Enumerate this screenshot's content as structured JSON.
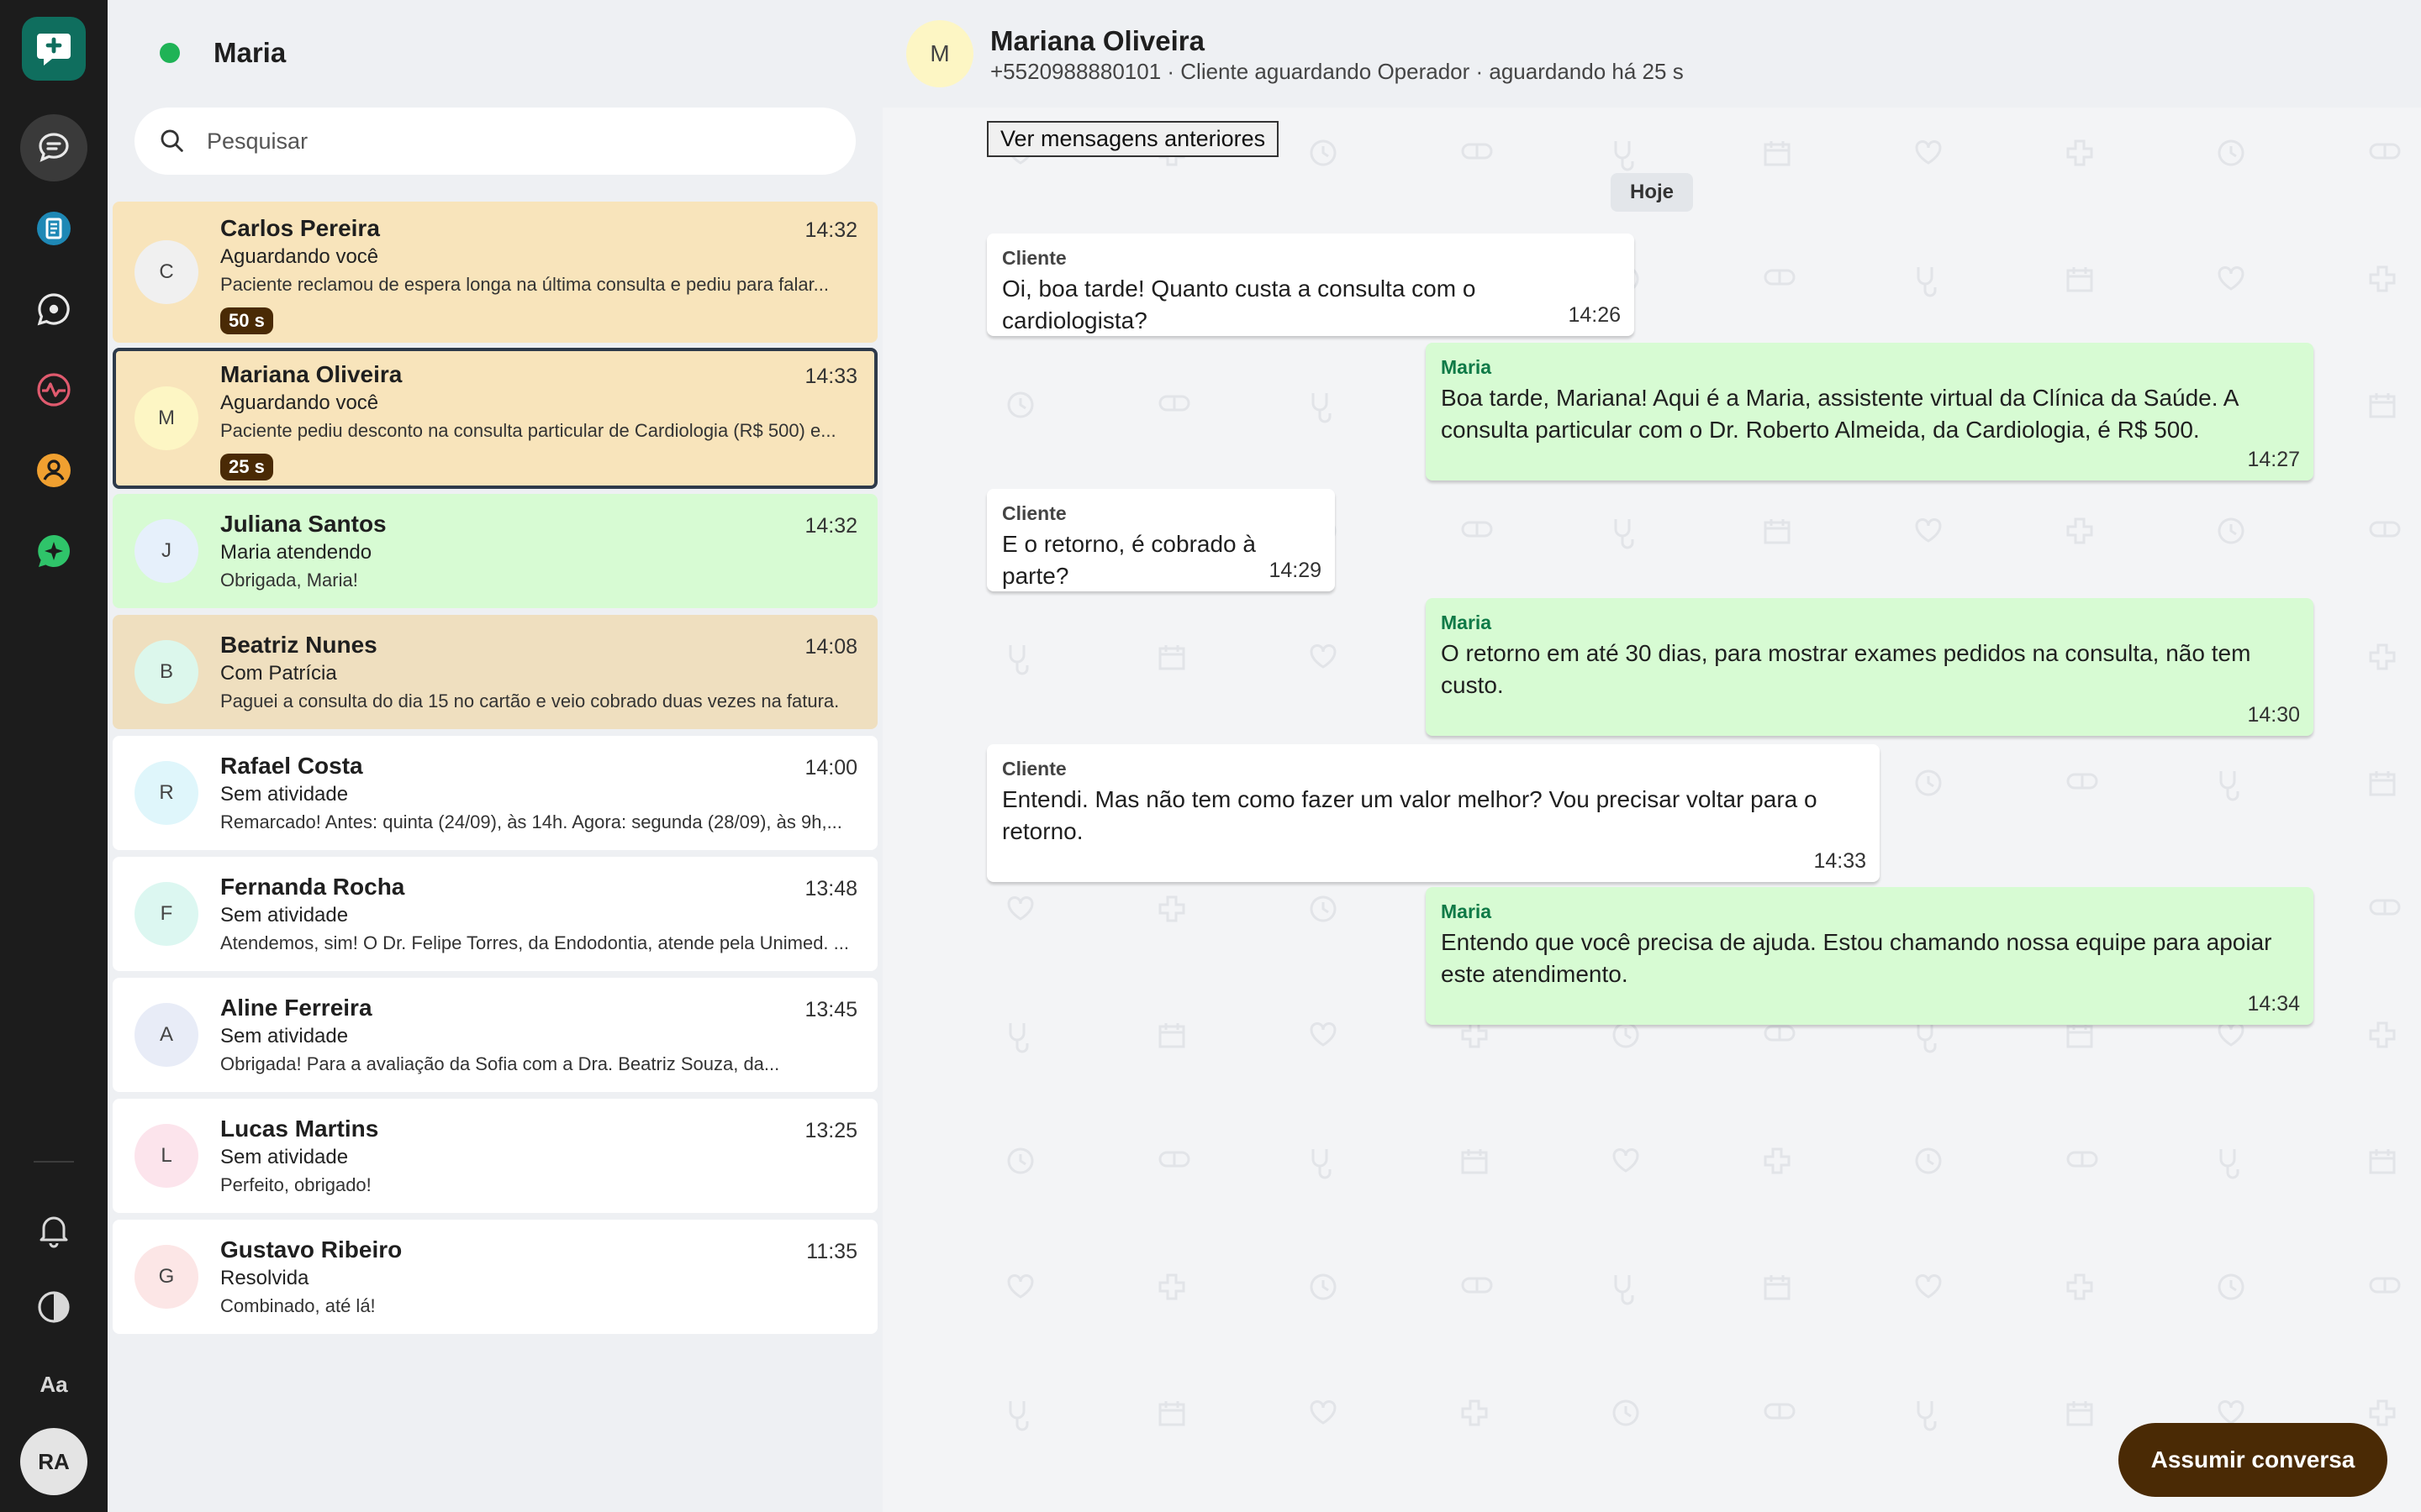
{
  "agent": {
    "name": "Maria",
    "status_color": "#1fb356"
  },
  "search": {
    "placeholder": "Pesquisar"
  },
  "conversations": [
    {
      "initial": "C",
      "name": "Carlos Pereira",
      "time": "14:32",
      "status": "Aguardando você",
      "preview": "Paciente reclamou de espera longa na última consulta e pediu para falar...",
      "badge": "50 s",
      "color": "#f8e4bb",
      "avatar_bg": "#f0f0f0"
    },
    {
      "initial": "M",
      "name": "Mariana Oliveira",
      "time": "14:33",
      "status": "Aguardando você",
      "preview": "Paciente pediu desconto na consulta particular de Cardiologia (R$ 500) e...",
      "badge": "25 s",
      "color": "#f8e4bb",
      "avatar_bg": "#fdf6c4",
      "selected": true
    },
    {
      "initial": "J",
      "name": "Juliana Santos",
      "time": "14:32",
      "status": "Maria atendendo",
      "preview": "Obrigada, Maria!",
      "color": "#d7fbd3",
      "avatar_bg": "#e6f0fb"
    },
    {
      "initial": "B",
      "name": "Beatriz Nunes",
      "time": "14:08",
      "status": "Com Patrícia",
      "preview": "Paguei a consulta do dia 15 no cartão e veio cobrado duas vezes na fatura.",
      "color": "#efdfbf",
      "avatar_bg": "#dcf7ec"
    },
    {
      "initial": "R",
      "name": "Rafael Costa",
      "time": "14:00",
      "status": "Sem atividade",
      "preview": "Remarcado! Antes: quinta (24/09), às 14h. Agora: segunda (28/09), às 9h,...",
      "color": "#ffffff",
      "avatar_bg": "#dff6fb"
    },
    {
      "initial": "F",
      "name": "Fernanda Rocha",
      "time": "13:48",
      "status": "Sem atividade",
      "preview": "Atendemos, sim! O Dr. Felipe Torres, da Endodontia, atende pela Unimed. ...",
      "color": "#ffffff",
      "avatar_bg": "#dcf7f1"
    },
    {
      "initial": "A",
      "name": "Aline Ferreira",
      "time": "13:45",
      "status": "Sem atividade",
      "preview": "Obrigada! Para a avaliação da Sofia com a Dra. Beatriz Souza, da...",
      "color": "#ffffff",
      "avatar_bg": "#e8ecf7"
    },
    {
      "initial": "L",
      "name": "Lucas Martins",
      "time": "13:25",
      "status": "Sem atividade",
      "preview": "Perfeito, obrigado!",
      "color": "#ffffff",
      "avatar_bg": "#fce4ec"
    },
    {
      "initial": "G",
      "name": "Gustavo Ribeiro",
      "time": "11:35",
      "status": "Resolvida",
      "preview": "Combinado, até lá!",
      "color": "#ffffff",
      "avatar_bg": "#fce6e6"
    }
  ],
  "chat": {
    "avatar_initial": "M",
    "contact_name": "Mariana Oliveira",
    "subtitle": "+5520988880101 · Cliente aguardando Operador · aguardando há 25 s",
    "older_button": "Ver mensagens anteriores",
    "day_label": "Hoje",
    "messages": [
      {
        "dir": "in",
        "sender": "Cliente",
        "text": "Oi, boa tarde! Quanto custa a consulta com o cardiologista?",
        "time": "14:26"
      },
      {
        "dir": "out",
        "sender": "Maria",
        "text": "Boa tarde, Mariana! Aqui é a Maria, assistente virtual da Clínica da Saúde. A consulta particular com o Dr. Roberto Almeida, da Cardiologia, é R$ 500.",
        "time": "14:27"
      },
      {
        "dir": "in",
        "sender": "Cliente",
        "text": "E o retorno, é cobrado à parte?",
        "time": "14:29"
      },
      {
        "dir": "out",
        "sender": "Maria",
        "text": "O retorno em até 30 dias, para mostrar exames pedidos na consulta, não tem custo.",
        "time": "14:30"
      },
      {
        "dir": "in",
        "sender": "Cliente",
        "text": "Entendi. Mas não tem como fazer um valor melhor? Vou precisar voltar para o retorno.",
        "time": "14:33"
      },
      {
        "dir": "out",
        "sender": "Maria",
        "text": "Entendo que você precisa de ajuda. Estou chamando nossa equipe para apoiar este atendimento.",
        "time": "14:34"
      }
    ],
    "assume_button": "Assumir conversa"
  },
  "rail": {
    "icons": [
      "app-logo-icon",
      "chat-bubble-icon",
      "document-icon",
      "chat-circle-icon",
      "pulse-icon",
      "user-icon",
      "sparkle-icon"
    ],
    "bottom_icons": [
      "bell-icon",
      "contrast-icon"
    ],
    "font_label": "Aa",
    "user_initials": "RA"
  },
  "colors": {
    "accent_dark": "#4a2a05",
    "outgoing_bubble": "#d7fbd3",
    "brand": "#0f6e5e"
  }
}
